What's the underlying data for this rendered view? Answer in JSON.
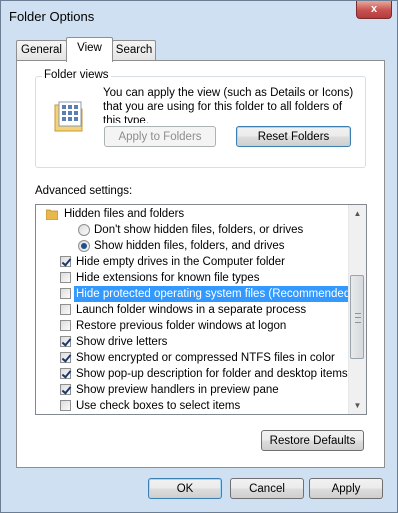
{
  "window": {
    "title": "Folder Options",
    "close_glyph": "x"
  },
  "tabs": [
    {
      "label": "General",
      "active": false
    },
    {
      "label": "View",
      "active": true
    },
    {
      "label": "Search",
      "active": false
    }
  ],
  "folder_views": {
    "group_label": "Folder views",
    "description": "You can apply the view (such as Details or Icons) that you are using for this folder to all folders of this type.",
    "apply_label": "Apply to Folders",
    "reset_label": "Reset Folders"
  },
  "advanced": {
    "label": "Advanced settings:",
    "items": [
      {
        "text": "Hidden files and folders",
        "kind": "folder"
      },
      {
        "text": "Don't show hidden files, folders, or drives",
        "kind": "radio",
        "checked": false
      },
      {
        "text": "Show hidden files, folders, and drives",
        "kind": "radio",
        "checked": true
      },
      {
        "text": "Hide empty drives in the Computer folder",
        "kind": "checkbox",
        "checked": true
      },
      {
        "text": "Hide extensions for known file types",
        "kind": "checkbox",
        "checked": false
      },
      {
        "text": "Hide protected operating system files (Recommended)",
        "kind": "checkbox",
        "checked": false,
        "selected": true
      },
      {
        "text": "Launch folder windows in a separate process",
        "kind": "checkbox",
        "checked": false
      },
      {
        "text": "Restore previous folder windows at logon",
        "kind": "checkbox",
        "checked": false
      },
      {
        "text": "Show drive letters",
        "kind": "checkbox",
        "checked": true
      },
      {
        "text": "Show encrypted or compressed NTFS files in color",
        "kind": "checkbox",
        "checked": true
      },
      {
        "text": "Show pop-up description for folder and desktop items",
        "kind": "checkbox",
        "checked": true
      },
      {
        "text": "Show preview handlers in preview pane",
        "kind": "checkbox",
        "checked": true
      },
      {
        "text": "Use check boxes to select items",
        "kind": "checkbox",
        "checked": false
      }
    ],
    "restore_label": "Restore Defaults"
  },
  "buttons": {
    "ok": "OK",
    "cancel": "Cancel",
    "apply": "Apply"
  },
  "colors": {
    "selection": "#3399ff",
    "close": "#c75050"
  }
}
